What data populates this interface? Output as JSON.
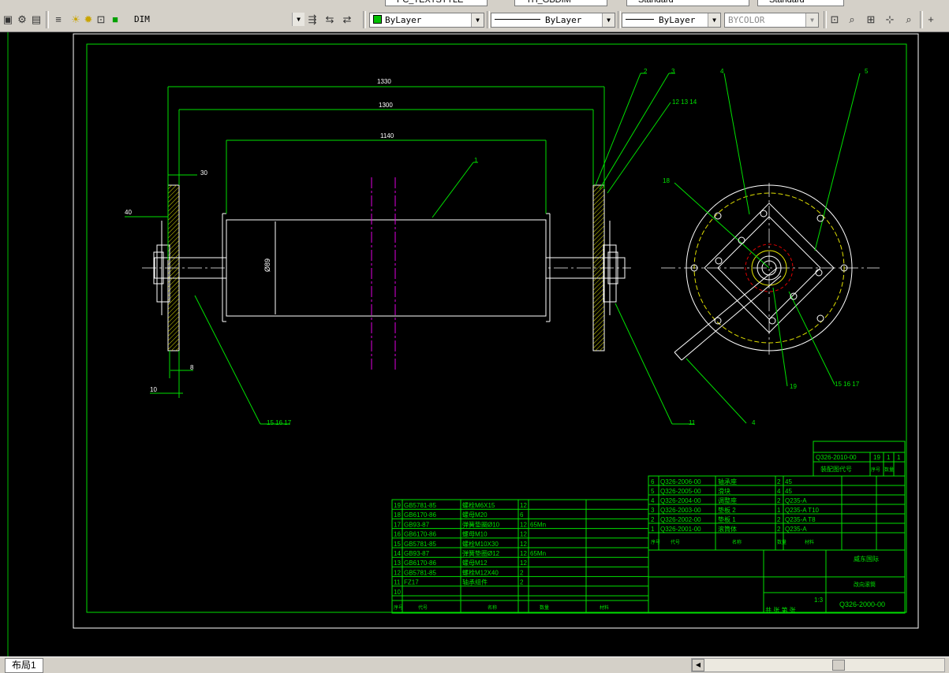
{
  "toolbar_top": {
    "text_style": "PC_TEXTSTYLE",
    "dim_style": "TH_GBDIM",
    "table_style": "Standard",
    "mleader_style": "Standard"
  },
  "toolbar": {
    "layer_name": "DIM",
    "color": "ByLayer",
    "linetype": "ByLayer",
    "lineweight": "ByLayer",
    "plotstyle": "BYCOLOR"
  },
  "colors": {
    "layer_green": "#00c000",
    "background": "#000000"
  },
  "drawing": {
    "dims": {
      "overall": "1330",
      "bearings": "1300",
      "drum": "1140",
      "d30": "30",
      "d40": "40",
      "d8": "8",
      "d10": "10",
      "dia": "Ø89"
    },
    "balloons": [
      "1",
      "2",
      "3",
      "12 13 14",
      "4",
      "5",
      "18",
      "19",
      "15 16 17",
      "4",
      "11",
      "15 16 17"
    ]
  },
  "title_block": {
    "top_code": "Q326-2010-00",
    "top_cells": [
      "19",
      "1",
      "1"
    ],
    "top_header": [
      "装配图代号",
      "序号",
      "数量"
    ],
    "parts": [
      {
        "no": "6",
        "code": "Q326-2006-00",
        "name": "轴承座",
        "qty": "2",
        "mat": "45"
      },
      {
        "no": "5",
        "code": "Q326-2005-00",
        "name": "滑块",
        "qty": "4",
        "mat": "45"
      },
      {
        "no": "4",
        "code": "Q326-2004-00",
        "name": "调整座",
        "qty": "2",
        "mat": "Q235-A"
      },
      {
        "no": "3",
        "code": "Q326-2003-00",
        "name": "垫板 2",
        "qty": "1",
        "mat": "Q235-A T10"
      },
      {
        "no": "2",
        "code": "Q326-2002-00",
        "name": "垫板 1",
        "qty": "2",
        "mat": "Q235-A T8"
      },
      {
        "no": "1",
        "code": "Q326-2001-00",
        "name": "滚筒体",
        "qty": "2",
        "mat": "Q235-A"
      }
    ],
    "std_parts": [
      {
        "no": "19",
        "code": "GB5781-85",
        "name": "螺栓M6X15",
        "qty": "12",
        "mat": ""
      },
      {
        "no": "18",
        "code": "GB6170-86",
        "name": "螺母M20",
        "qty": "6",
        "mat": ""
      },
      {
        "no": "17",
        "code": "GB93-87",
        "name": "弹簧垫圈Ø10",
        "qty": "12",
        "mat": "65Mn"
      },
      {
        "no": "16",
        "code": "GB6170-86",
        "name": "螺母M10",
        "qty": "12",
        "mat": ""
      },
      {
        "no": "15",
        "code": "GB5781-85",
        "name": "螺栓M10X30",
        "qty": "12",
        "mat": ""
      },
      {
        "no": "14",
        "code": "GB93-87",
        "name": "弹簧垫圈Ø12",
        "qty": "12",
        "mat": "65Mn"
      },
      {
        "no": "13",
        "code": "GB6170-86",
        "name": "螺母M12",
        "qty": "12",
        "mat": ""
      },
      {
        "no": "12",
        "code": "GB5781-85",
        "name": "螺栓M12X40",
        "qty": "2",
        "mat": ""
      },
      {
        "no": "11",
        "code": "FZ17",
        "name": "轴承组件",
        "qty": "2",
        "mat": ""
      },
      {
        "no": "10",
        "code": "",
        "name": "",
        "qty": "",
        "mat": ""
      }
    ],
    "header_cols": [
      "序号",
      "代号",
      "名称",
      "数量",
      "材料"
    ],
    "company": "威东国际",
    "title": "改向滚筒",
    "scale": "1:3",
    "drawing_no": "Q326-2000-00",
    "sheet": "共 张 第 张"
  },
  "statusbar": {
    "layout_tab": "布局1"
  }
}
